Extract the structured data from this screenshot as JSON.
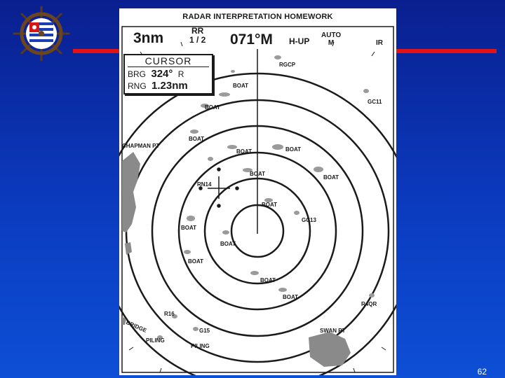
{
  "slide": {
    "page_number": "62"
  },
  "homework": {
    "title": "RADAR INTERPRETATION  HOMEWORK",
    "range_scale": "3nm",
    "range_rings_label": "RR",
    "range_rings_value": "1 / 2",
    "heading": "071°M",
    "orientation": "H-UP",
    "gain_mode": "AUTO",
    "gain_mode_sub": "M",
    "ir_label": "IR",
    "cursor": {
      "title": "CURSOR",
      "brg_label": "BRG",
      "brg_value": "324°",
      "brg_ref": "R",
      "rng_label": "RNG",
      "rng_value": "1.23nm"
    }
  },
  "marks": {
    "rgcp": "RGCP",
    "gc11": "GC11",
    "chapman_pt": "CHAPMAN PT",
    "rn14": "RN14",
    "gc13": "GC13",
    "r4qr": "R4QR",
    "r16": "R16",
    "bridge": "BRIDGE",
    "g15": "G15",
    "piling_1": "PILING",
    "piling_2": "PILING",
    "swan_pt": "SWAN PT",
    "boat": "BOAT"
  }
}
